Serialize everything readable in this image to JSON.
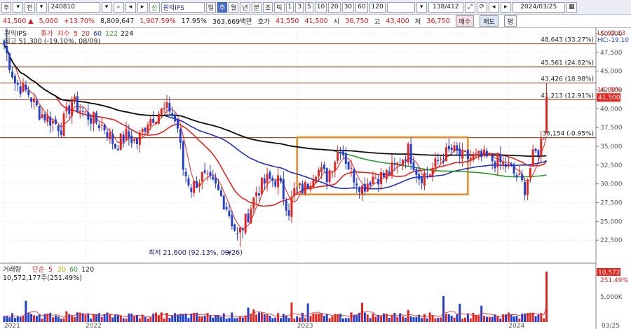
{
  "toolbar": {
    "mode": "주",
    "prev_label": "전",
    "code": "240810",
    "name": "원익IPS",
    "periods": [
      "일",
      "주",
      "월",
      "년",
      "분",
      "초",
      "틱"
    ],
    "active_period": "주",
    "intervals": [
      "1",
      "3",
      "5",
      "10",
      "20",
      "30",
      "60",
      "120"
    ],
    "counter": "138/412",
    "date": "2024/03/25"
  },
  "quote": {
    "price": "41,500",
    "change": "5,000",
    "change_pct": "+13.70%",
    "volume": "8,809,647",
    "volume_ratio": "1,907.59%",
    "turnover_pct": "17.95%",
    "amount": "363,669백만",
    "bid_label": "호가",
    "bid1": "41,550",
    "bid2": "41,500",
    "open_label": "시",
    "open": "36,750",
    "high_label": "고",
    "high": "43,400",
    "low_label": "저",
    "low": "36,750",
    "buy_label": "매수",
    "sell_label": "매도",
    "flat_label": "평"
  },
  "legend": {
    "name": "원익IPS",
    "price_type": "종가",
    "ma_label": "지수",
    "ma_periods": [
      "5",
      "20",
      "60",
      "122",
      "224"
    ],
    "high_note": "최고 51,300 (-19.10%, 08/09)",
    "low_note": "최저 21,600 (92.13%, 09/26)"
  },
  "right_info": {
    "lc": "LC:92.13",
    "hc": "HC:-19.10"
  },
  "volume_legend": {
    "title": "거래량",
    "ma_label": "단순",
    "ma_periods": [
      "5",
      "20",
      "60",
      "120"
    ],
    "value": "10,572,177주(251.49%)"
  },
  "volume_axis": {
    "tick": "5,000K",
    "current": "10,572K",
    "current_pct": "251.49%"
  },
  "colors": {
    "up": "#e8231c",
    "down": "#1f3ed6",
    "ma5": "#e8231c",
    "ma20": "#e8231c",
    "ma60": "#2030c0",
    "ma122": "#2a9a2a",
    "ma224": "#111111",
    "box": "#e98a2a",
    "level": "#a05030"
  },
  "chart_data": {
    "type": "candlestick",
    "y_axis": {
      "min": 20000,
      "max": 50000,
      "ticks": [
        22500,
        25000,
        27500,
        30000,
        32500,
        35000,
        37500,
        40000,
        42500,
        45000,
        47500,
        50000
      ]
    },
    "y_tick_labels": [
      "22,500",
      "25,000",
      "27,500",
      "30,000",
      "32,500",
      "35,000",
      "37,500",
      "40,000",
      "42,500",
      "45,000",
      "47,500",
      "50,000"
    ],
    "current_price": 41500,
    "current_price_label": "41,500",
    "current_pct_label": "16.08%",
    "levels": [
      {
        "value": 48643,
        "label": "48,643 (33.27%)"
      },
      {
        "value": 45561,
        "label": "45,561 (24.82%)"
      },
      {
        "value": 43426,
        "label": "43,426 (18.98%)"
      },
      {
        "value": 41213,
        "label": "41,213 (12.91%)"
      },
      {
        "value": 36154,
        "label": "36,154 (-0.95%)"
      }
    ],
    "box": {
      "from_week": 108,
      "to_week": 171,
      "low": 28600,
      "high": 36200
    },
    "x_labels": [
      {
        "week": 0,
        "label": "2021"
      },
      {
        "week": 30,
        "label": "2022"
      },
      {
        "week": 108,
        "label": "2023"
      },
      {
        "week": 186,
        "label": "2024"
      },
      {
        "week": 211,
        "label": "03/25"
      }
    ],
    "low_marker": {
      "week": 87,
      "value": 21600
    },
    "high_marker": {
      "week": 1,
      "value": 51300
    },
    "anchors": [
      [
        0,
        48500
      ],
      [
        4,
        43500
      ],
      [
        9,
        42000
      ],
      [
        13,
        39500
      ],
      [
        17,
        38500
      ],
      [
        21,
        37500
      ],
      [
        25,
        41000
      ],
      [
        29,
        39500
      ],
      [
        33,
        38500
      ],
      [
        37,
        37500
      ],
      [
        41,
        35000
      ],
      [
        45,
        36500
      ],
      [
        49,
        35500
      ],
      [
        53,
        38500
      ],
      [
        57,
        39500
      ],
      [
        61,
        40000
      ],
      [
        64,
        37500
      ],
      [
        66,
        32000
      ],
      [
        69,
        29500
      ],
      [
        73,
        31000
      ],
      [
        78,
        29500
      ],
      [
        82,
        27000
      ],
      [
        86,
        23000
      ],
      [
        89,
        25000
      ],
      [
        93,
        29000
      ],
      [
        97,
        30500
      ],
      [
        101,
        30500
      ],
      [
        105,
        26500
      ],
      [
        107,
        29000
      ],
      [
        111,
        29500
      ],
      [
        115,
        32000
      ],
      [
        119,
        31000
      ],
      [
        124,
        35000
      ],
      [
        128,
        31500
      ],
      [
        132,
        29500
      ],
      [
        136,
        31000
      ],
      [
        140,
        31000
      ],
      [
        145,
        32500
      ],
      [
        149,
        34500
      ],
      [
        153,
        31000
      ],
      [
        157,
        31500
      ],
      [
        161,
        33500
      ],
      [
        165,
        34500
      ],
      [
        169,
        33500
      ],
      [
        173,
        33500
      ],
      [
        177,
        33500
      ],
      [
        181,
        33000
      ],
      [
        185,
        32500
      ],
      [
        189,
        31000
      ],
      [
        192,
        29500
      ],
      [
        195,
        33500
      ],
      [
        197,
        34500
      ],
      [
        199,
        36750
      ],
      [
        200,
        41500
      ]
    ]
  }
}
